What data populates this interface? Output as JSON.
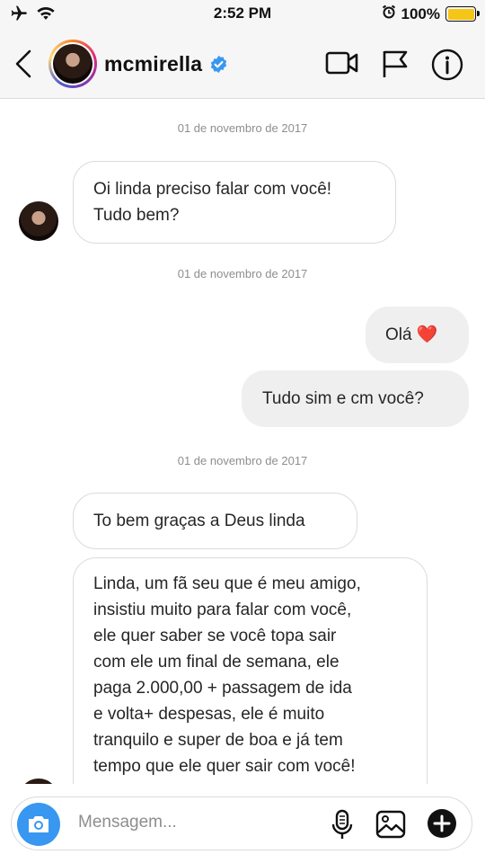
{
  "status_bar": {
    "time": "2:52 PM",
    "battery_percent": "100%",
    "battery_level": 1.0,
    "icons": [
      "airplane-icon",
      "wifi-icon",
      "alarm-icon",
      "battery-icon"
    ]
  },
  "header": {
    "username": "mcmirella",
    "verified": true,
    "icons": [
      "back-chevron-icon",
      "video-call-icon",
      "flag-icon",
      "info-icon"
    ]
  },
  "conversation": {
    "dates": [
      "01 de novembro de 2017",
      "01 de novembro de 2017",
      "01 de novembro de 2017"
    ],
    "messages": [
      {
        "direction": "incoming",
        "lines": [
          "Oi linda preciso falar com você!",
          "Tudo bem?"
        ]
      },
      {
        "direction": "outgoing",
        "text": "Olá ❤️"
      },
      {
        "direction": "outgoing",
        "text": "Tudo sim e cm você?"
      },
      {
        "direction": "incoming",
        "text": "To bem graças a Deus linda"
      },
      {
        "direction": "incoming",
        "lines": [
          "Linda, um fã seu que é meu amigo,",
          "insistiu muito para falar com você,",
          "ele quer saber se você topa sair",
          "com ele um final de semana, ele",
          "paga 2.000,00 + passagem de ida",
          "e volta+ despesas, ele é muito",
          "tranquilo e super de boa e já tem",
          "tempo que ele quer sair com você!"
        ]
      }
    ]
  },
  "composer": {
    "placeholder": "Mensagem...",
    "icons": [
      "camera-icon",
      "microphone-icon",
      "gallery-icon",
      "add-icon"
    ]
  },
  "colors": {
    "accent": "#3897f0",
    "verified": "#3897f0",
    "heart": "#e0245e",
    "battery": "#f5c518"
  }
}
